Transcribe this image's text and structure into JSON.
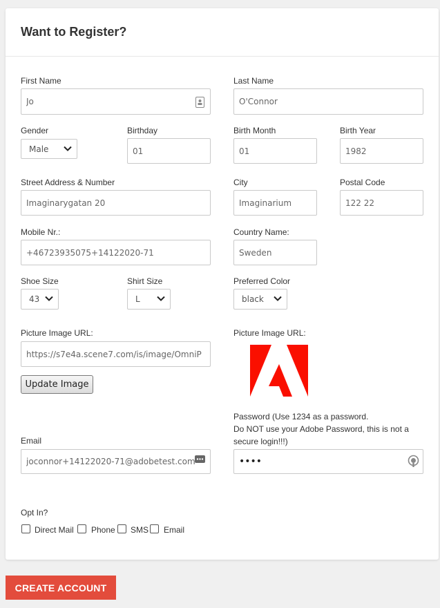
{
  "form": {
    "title": "Want to Register?",
    "first_name": {
      "label": "First Name",
      "value": "Jo"
    },
    "last_name": {
      "label": "Last Name",
      "value": "O'Connor"
    },
    "gender": {
      "label": "Gender",
      "value": "Male"
    },
    "birthday": {
      "label": "Birthday",
      "value": "01"
    },
    "birth_month": {
      "label": "Birth Month",
      "value": "01"
    },
    "birth_year": {
      "label": "Birth Year",
      "value": "1982"
    },
    "street": {
      "label": "Street Address & Number",
      "value": "Imaginarygatan 20"
    },
    "city": {
      "label": "City",
      "value": "Imaginarium"
    },
    "postal_code": {
      "label": "Postal Code",
      "value": "122 22"
    },
    "mobile": {
      "label": "Mobile Nr.:",
      "value": "+46723935075+14122020-71"
    },
    "country": {
      "label": "Country Name:",
      "value": "Sweden"
    },
    "shoe_size": {
      "label": "Shoe Size",
      "value": "43"
    },
    "shirt_size": {
      "label": "Shirt Size",
      "value": "L"
    },
    "preferred_color": {
      "label": "Preferred Color",
      "value": "black"
    },
    "picture_url": {
      "label": "Picture Image URL:",
      "value": "https://s7e4a.scene7.com/is/image/OmniP"
    },
    "picture_preview_label": "Picture Image URL:",
    "update_image_label": "Update Image",
    "email": {
      "label": "Email",
      "value": "joconnor+14122020-71@adobetest.com"
    },
    "password": {
      "label_line1": "Password (Use 1234 as a password.",
      "label_line2": "Do NOT use your Adobe Password, this is not a",
      "label_line3": "secure login!!!)",
      "value": "1234"
    },
    "opt_in": {
      "label": "Opt In?",
      "options": [
        "Direct Mail",
        "Phone",
        "SMS",
        "Email"
      ]
    }
  },
  "create_account_label": "CREATE ACCOUNT",
  "colors": {
    "accent": "#e34c3c",
    "logo_red": "#fa0f00"
  },
  "icons": [
    "contact-card-icon",
    "adobe-logo",
    "password-dots-icon",
    "password-manager-icon",
    "chevron-down-icon"
  ]
}
